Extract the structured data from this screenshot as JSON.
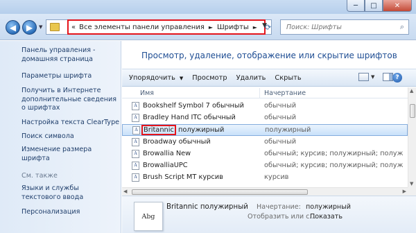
{
  "window": {
    "controls": {
      "minimize": "─",
      "maximize": "□",
      "close": "✕"
    }
  },
  "address": {
    "breadcrumbs": [
      "Все элементы панели управления",
      "Шрифты"
    ],
    "lead_chevron": "«",
    "separator": "►",
    "search_placeholder": "Поиск: Шрифты"
  },
  "sidebar": {
    "home": "Панель управления - домашняя страница",
    "tasks": [
      "Параметры шрифта",
      "Получить в Интернете дополнительные сведения о шрифтах",
      "Настройка текста ClearType",
      "Поиск символа",
      "Изменение размера шрифта"
    ],
    "see_also_title": "См. также",
    "see_also": [
      "Языки и службы текстового ввода",
      "Персонализация"
    ]
  },
  "main": {
    "heading": "Просмотр, удаление, отображение или скрытие шрифтов"
  },
  "toolbar": {
    "organize": "Упорядочить",
    "preview": "Просмотр",
    "delete": "Удалить",
    "hide": "Скрыть",
    "help": "?"
  },
  "columns": {
    "name": "Имя",
    "type": "Начертание"
  },
  "fonts": [
    {
      "name": "Bookshelf Symbol 7 обычный",
      "style": "обычный"
    },
    {
      "name": "Bradley Hand ITC обычный",
      "style": "обычный"
    },
    {
      "name_a": "Britannic",
      "name_b": " полужирный",
      "style": "полужирный",
      "selected": true
    },
    {
      "name": "Broadway обычный",
      "style": "обычный"
    },
    {
      "name": "Browallia New",
      "style": "обычный; курсив; полужирный; полужирный курсив"
    },
    {
      "name": "BrowalliaUPC",
      "style": "обычный; курсив; полужирный; полужирный курсив"
    },
    {
      "name": "Brush Script MT курсив",
      "style": "курсив"
    }
  ],
  "details": {
    "preview_text": "Abg",
    "title": "Britannic полужирный",
    "style_label": "Начертание:",
    "style_value": "полужирный",
    "show_label": "Отобразить или с...",
    "show_value": "Показать"
  }
}
